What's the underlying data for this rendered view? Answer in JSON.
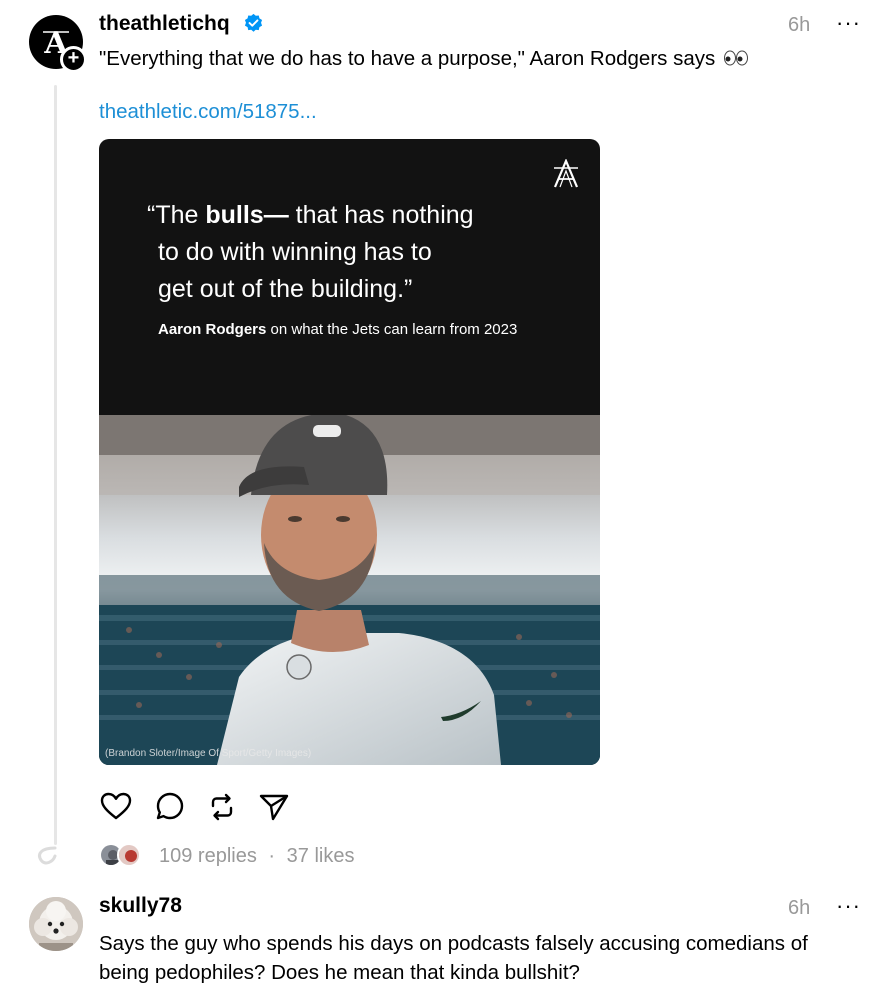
{
  "post": {
    "username": "theathletichq",
    "time": "6h",
    "more_label": "···",
    "text": "\"Everything that we do has to have a purpose,\" Aaron Rodgers says",
    "emoji": "eyes-emoji",
    "link": "theathletic.com/51875...",
    "card": {
      "quote_open": "“The ",
      "quote_bold": "bulls—",
      "quote_rest1": " that has nothing",
      "quote_line2": "to do with winning has to",
      "quote_line3": "get out of the building.”",
      "attrib_name": "Aaron Rodgers",
      "attrib_rest": " on what the Jets can learn from 2023",
      "credit": "(Brandon Sloter/Image Of Sport/Getty Images)"
    },
    "actions": [
      "heart-icon",
      "comment-icon",
      "repost-icon",
      "share-icon"
    ],
    "replies": "109 replies",
    "separator": "·",
    "likes": "37 likes"
  },
  "reply": {
    "username": "skully78",
    "time": "6h",
    "more_label": "···",
    "text": "Says the guy who spends his days on podcasts falsely accusing comedians of being pedophiles? Does he mean that kinda bullshit?"
  },
  "colors": {
    "link": "#1d8fd6",
    "verified": "#0095f6",
    "muted": "#999999",
    "card_bg": "#121212"
  }
}
